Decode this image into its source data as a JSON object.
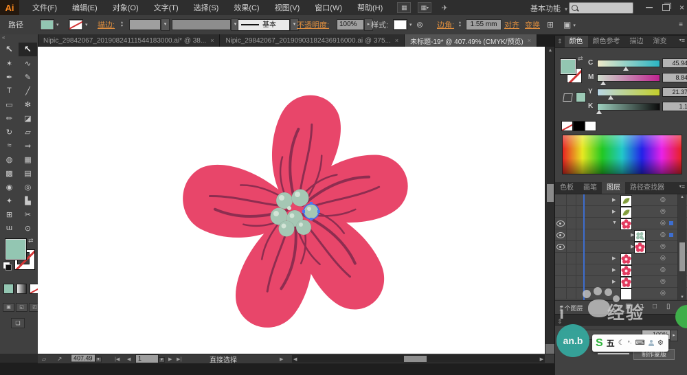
{
  "menubar": {
    "logo": "Ai",
    "items": [
      "文件(F)",
      "编辑(E)",
      "对象(O)",
      "文字(T)",
      "选择(S)",
      "效果(C)",
      "视图(V)",
      "窗口(W)",
      "帮助(H)"
    ],
    "workspace": "基本功能",
    "search_value": ""
  },
  "controlbar": {
    "context_label": "路径",
    "stroke_link": "描边:",
    "brush_definition": "基本",
    "opacity_link": "不透明度:",
    "opacity_value": "100%",
    "style_label": "样式:",
    "corner_link": "边角:",
    "corner_value": "1.55 mm",
    "align_link": "对齐",
    "transform_link": "变换"
  },
  "tabs": [
    {
      "title": "Nipic_29842067_20190824111544183000.ai* @ 38...",
      "active": false
    },
    {
      "title": "Nipic_29842067_20190903182436916000.ai @ 375...",
      "active": false
    },
    {
      "title": "未标题-19* @ 407.49% (CMYK/预览)",
      "active": true
    }
  ],
  "toolbar": {
    "tools": [
      {
        "name": "selection-tool",
        "glyph": "↖",
        "active": false
      },
      {
        "name": "direct-selection-tool",
        "glyph": "↖",
        "active": true
      },
      {
        "name": "magic-wand-tool",
        "glyph": "✶",
        "active": false
      },
      {
        "name": "lasso-tool",
        "glyph": "∿",
        "active": false
      },
      {
        "name": "pen-tool",
        "glyph": "✒",
        "active": false
      },
      {
        "name": "curvature-tool",
        "glyph": "✎",
        "active": false
      },
      {
        "name": "type-tool",
        "glyph": "T",
        "active": false
      },
      {
        "name": "line-segment-tool",
        "glyph": "╱",
        "active": false
      },
      {
        "name": "shaper-tool",
        "glyph": "▭",
        "active": false
      },
      {
        "name": "paintbrush-tool",
        "glyph": "✻",
        "active": false
      },
      {
        "name": "pencil-tool",
        "glyph": "✏",
        "active": false
      },
      {
        "name": "eraser-tool",
        "glyph": "◪",
        "active": false
      },
      {
        "name": "rotate-tool",
        "glyph": "↻",
        "active": false
      },
      {
        "name": "scale-tool",
        "glyph": "▱",
        "active": false
      },
      {
        "name": "width-tool",
        "glyph": "≈",
        "active": false
      },
      {
        "name": "free-transform-tool",
        "glyph": "⇒",
        "active": false
      },
      {
        "name": "shape-builder-tool",
        "glyph": "◍",
        "active": false
      },
      {
        "name": "perspective-grid-tool",
        "glyph": "▦",
        "active": false
      },
      {
        "name": "mesh-tool",
        "glyph": "▩",
        "active": false
      },
      {
        "name": "gradient-tool",
        "glyph": "▤",
        "active": false
      },
      {
        "name": "eyedropper-tool",
        "glyph": "◉",
        "active": false
      },
      {
        "name": "blend-tool",
        "glyph": "◎",
        "active": false
      },
      {
        "name": "symbol-sprayer-tool",
        "glyph": "✦",
        "active": false
      },
      {
        "name": "column-graph-tool",
        "glyph": "▙",
        "active": false
      },
      {
        "name": "artboard-tool",
        "glyph": "⊞",
        "active": false
      },
      {
        "name": "slice-tool",
        "glyph": "✂",
        "active": false
      },
      {
        "name": "hand-tool",
        "glyph": "ɯ",
        "active": false
      },
      {
        "name": "zoom-tool",
        "glyph": "⊙",
        "active": false
      }
    ]
  },
  "color_panel": {
    "tabs": [
      "颜色",
      "颜色参考",
      "描边",
      "渐变"
    ],
    "active_tab": "颜色",
    "channels": [
      {
        "label": "C",
        "value": "45.94",
        "unit": "%",
        "pos": 46
      },
      {
        "label": "M",
        "value": "8.84",
        "unit": "%",
        "pos": 9
      },
      {
        "label": "Y",
        "value": "21.37",
        "unit": "%",
        "pos": 21
      },
      {
        "label": "K",
        "value": "1.1",
        "unit": "%",
        "pos": 2
      }
    ]
  },
  "lower_tabs": {
    "items": [
      "色板",
      "画笔",
      "图层",
      "路径查找器"
    ],
    "active": "图层"
  },
  "layers": {
    "rows": [
      {
        "thumb": "leaf",
        "eye": false,
        "arrow": "right",
        "indent": false,
        "selected": false
      },
      {
        "thumb": "leaf",
        "eye": false,
        "arrow": "right",
        "indent": false,
        "selected": false
      },
      {
        "thumb": "flower",
        "eye": true,
        "arrow": "down",
        "indent": false,
        "selected": true
      },
      {
        "thumb": "dots",
        "eye": true,
        "arrow": "right",
        "indent": true,
        "selected": true
      },
      {
        "thumb": "flower",
        "eye": true,
        "arrow": "right",
        "indent": true,
        "selected": false
      },
      {
        "thumb": "flower",
        "eye": false,
        "arrow": "right",
        "indent": false,
        "selected": false
      },
      {
        "thumb": "flower",
        "eye": false,
        "arrow": "right",
        "indent": false,
        "selected": false
      },
      {
        "thumb": "flower",
        "eye": false,
        "arrow": "right",
        "indent": false,
        "selected": false
      },
      {
        "thumb": "blank",
        "eye": false,
        "arrow": "none",
        "indent": false,
        "selected": false
      }
    ],
    "status": "1 个图层"
  },
  "transparency": {
    "opacity_value": "100%",
    "make_mask": "制作蒙版"
  },
  "statusbar": {
    "zoom": "407.49",
    "artboard": "1",
    "tool": "直接选择"
  },
  "watermark": {
    "prefix": "i",
    "brand": "经验",
    "badge": "an.b",
    "ime_s": "S",
    "ime_wubi": "五",
    "ime_dots": "°·"
  },
  "icons": {
    "bridge": "▦",
    "arrange_documents": "▦",
    "share": "✈",
    "caret_down": "▾",
    "caret_up": "▴",
    "caret_right": "▸",
    "close": "×",
    "tab_close": "×",
    "collapse_panel": "«",
    "grip": "≡",
    "expand_panel": "⇕",
    "panel_menu": "≡",
    "swap_colors": "⇄",
    "recolor_artwork": "⊚",
    "align_art": "⊞",
    "snap_options": "▣",
    "arrow_right": "▶",
    "arrow_down": "▼",
    "target": "◎",
    "make_mask_icon": "▣",
    "new_sublayer": "↴",
    "new_layer": "□",
    "delete": "▯",
    "nav_first": "|◀",
    "nav_prev": "◀",
    "nav_next": "▶",
    "nav_last": "▶|",
    "scroll_up": "▲",
    "scroll_down": "▼",
    "status_misc": "▱",
    "export": "↗",
    "moon": "☾",
    "keyboard": "⌨",
    "wrench": "⚙"
  },
  "colors": {
    "fill_teal": "#93c6b2",
    "petal": "#e8466a",
    "vein": "#8e2d50",
    "stamen": "#a5c7b4",
    "stamen_highlight": "#d2e4d6",
    "selection_blue": "#3d6ed0",
    "accent_orange": "#dd8d3e"
  }
}
